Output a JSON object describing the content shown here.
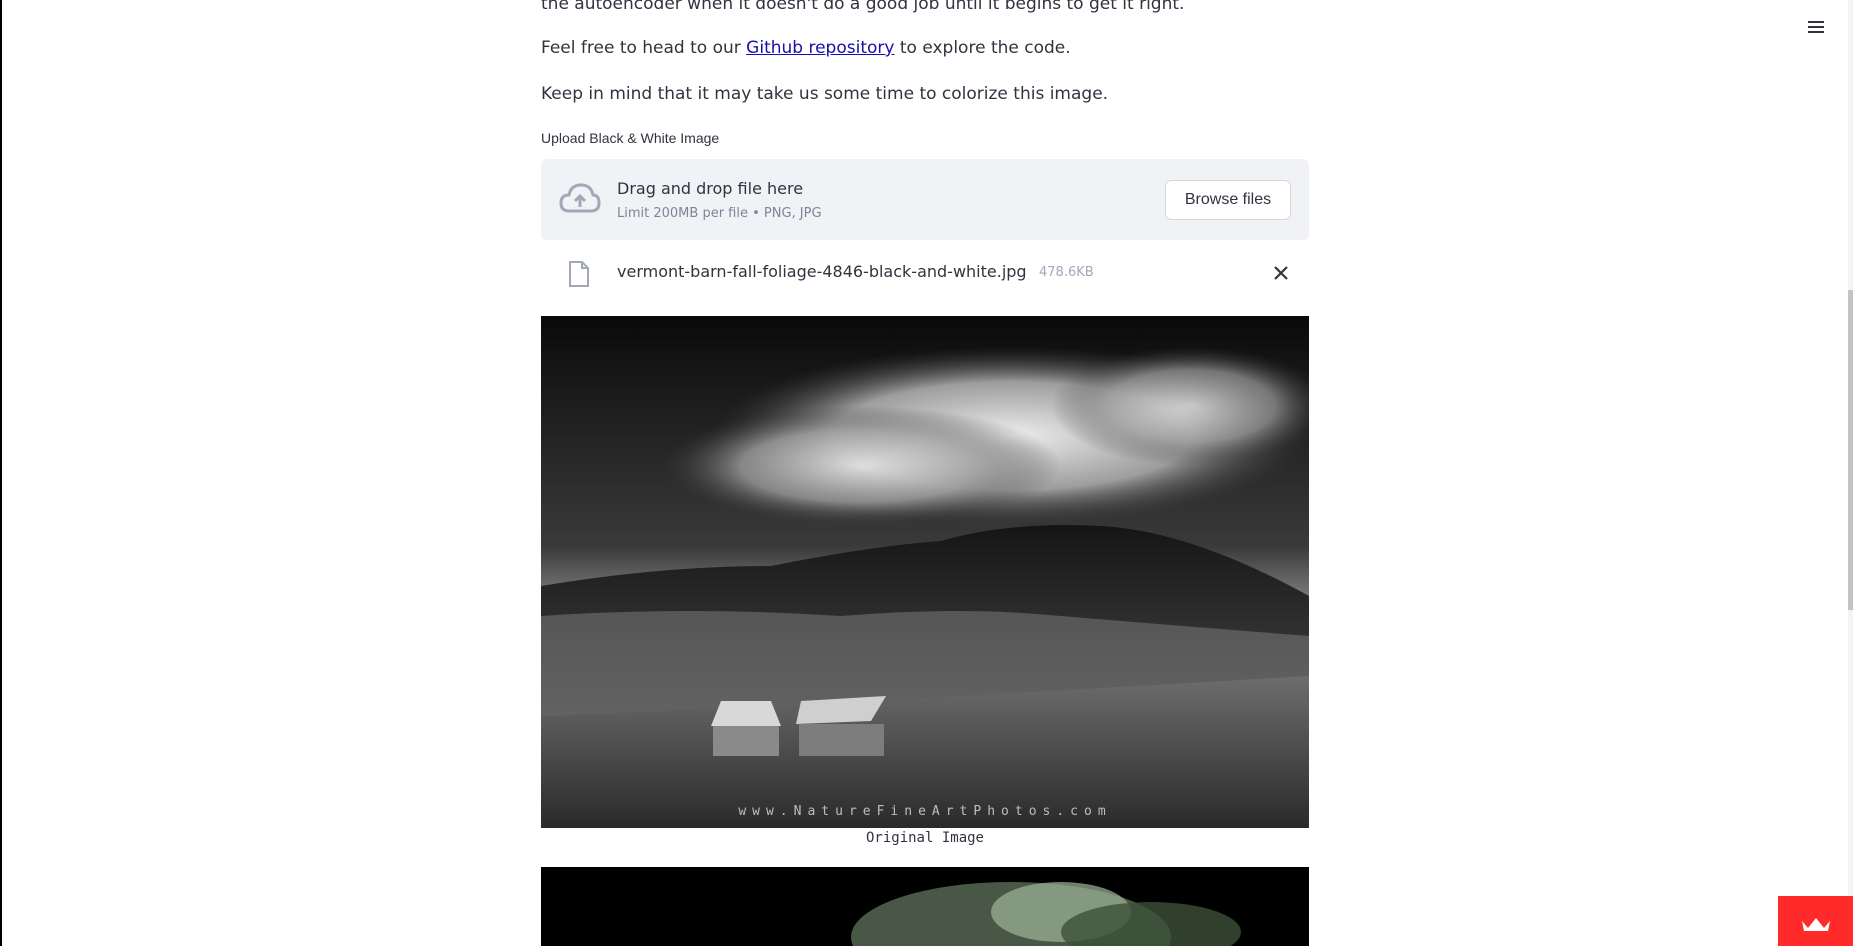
{
  "intro": {
    "partial_line": "the autoencoder when it doesn't do a good job until it begins to get it right.",
    "repo_prefix": "Feel free to head to our ",
    "repo_link": "Github repository",
    "repo_suffix": " to explore the code.",
    "wait_note": "Keep in mind that it may take us some time to colorize this image."
  },
  "uploader": {
    "label": "Upload Black & White Image",
    "drop_title": "Drag and drop file here",
    "drop_sub": "Limit 200MB per file • PNG, JPG",
    "browse_label": "Browse files"
  },
  "file": {
    "name": "vermont-barn-fall-foliage-4846-black-and-white.jpg",
    "size": "478.6KB"
  },
  "original": {
    "watermark": "www.NatureFineArtPhotos.com",
    "caption": "Original Image"
  },
  "colors": {
    "accent": "#ff2b2b",
    "link": "#1a0dab",
    "dropzone_bg": "#f0f2f6"
  },
  "icons": [
    "menu-icon",
    "cloud-upload-icon",
    "file-icon",
    "close-icon",
    "streamlit-logo-icon"
  ]
}
